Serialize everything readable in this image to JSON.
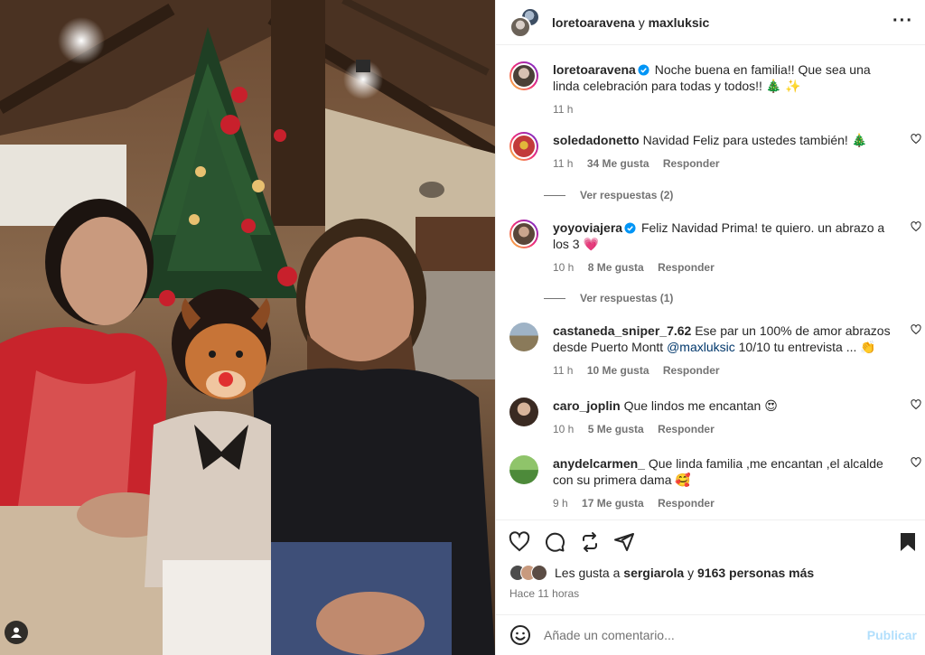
{
  "post": {
    "owner": "loretoaravena",
    "joiner": "y",
    "collaborator": "maxluksic",
    "more_icon": "more-horizontal-icon"
  },
  "caption": {
    "username": "loretoaravena",
    "text": "Noche buena en familia!! Que sea una linda celebración para todas y todos!! 🎄 ✨",
    "time": "11 h"
  },
  "comments": [
    {
      "username": "soledadonetto",
      "text": "Navidad Feliz para ustedes también! 🎄",
      "time": "11 h",
      "likes": "34 Me gusta",
      "reply": "Responder",
      "view_replies": "Ver respuestas (2)"
    },
    {
      "username": "yoyoviajera",
      "text": "Feliz Navidad Prima! te quiero. un abrazo a los 3 💗",
      "time": "10 h",
      "likes": "8 Me gusta",
      "reply": "Responder",
      "view_replies": "Ver respuestas (1)"
    },
    {
      "username": "castaneda_sniper_7.62",
      "text_before": "Ese par un 100% de amor abrazos desde Puerto Montt ",
      "mention": "@maxluksic",
      "text_after": " 10/10 tu entrevista ... 👏",
      "time": "11 h",
      "likes": "10 Me gusta",
      "reply": "Responder"
    },
    {
      "username": "caro_joplin",
      "text": "Que lindos me encantan 😍",
      "time": "10 h",
      "likes": "5 Me gusta",
      "reply": "Responder"
    },
    {
      "username": "anydelcarmen_",
      "text": "Que linda familia ,me encantan ,el alcalde con su primera dama 🥰",
      "time": "9 h",
      "likes": "17 Me gusta",
      "reply": "Responder"
    }
  ],
  "likes": {
    "prefix": "Les gusta a",
    "user": "sergiarola",
    "joiner": "y",
    "others": "9163 personas más"
  },
  "posted_ago": "Hace 11 horas",
  "composer": {
    "placeholder": "Añade un comentario...",
    "publish": "Publicar"
  },
  "colors": {
    "text": "#262626",
    "secondary": "#737373",
    "link": "#00376b",
    "verified": "#0095f6",
    "publish_disabled": "#b2dffc",
    "border": "#efefef"
  }
}
